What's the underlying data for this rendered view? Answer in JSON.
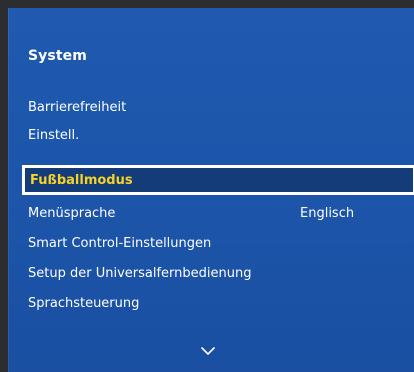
{
  "menu": {
    "title": "System",
    "items": [
      {
        "label": "Barrierefreiheit"
      },
      {
        "label": "Einstell."
      },
      {
        "label": "Fußballmodus",
        "selected": true
      },
      {
        "label": "Menüsprache",
        "value": "Englisch"
      },
      {
        "label": "Smart Control-Einstellungen"
      },
      {
        "label": "Setup der Universalfernbedienung"
      },
      {
        "label": "Sprachsteuerung"
      }
    ],
    "scroll_indicator_icon": "chevron-down-icon"
  },
  "colors": {
    "panel_blue": "#1c56ab",
    "selected_bg": "#133c78",
    "selected_text": "#f6d22b",
    "frame_dark": "#2b2d30"
  }
}
